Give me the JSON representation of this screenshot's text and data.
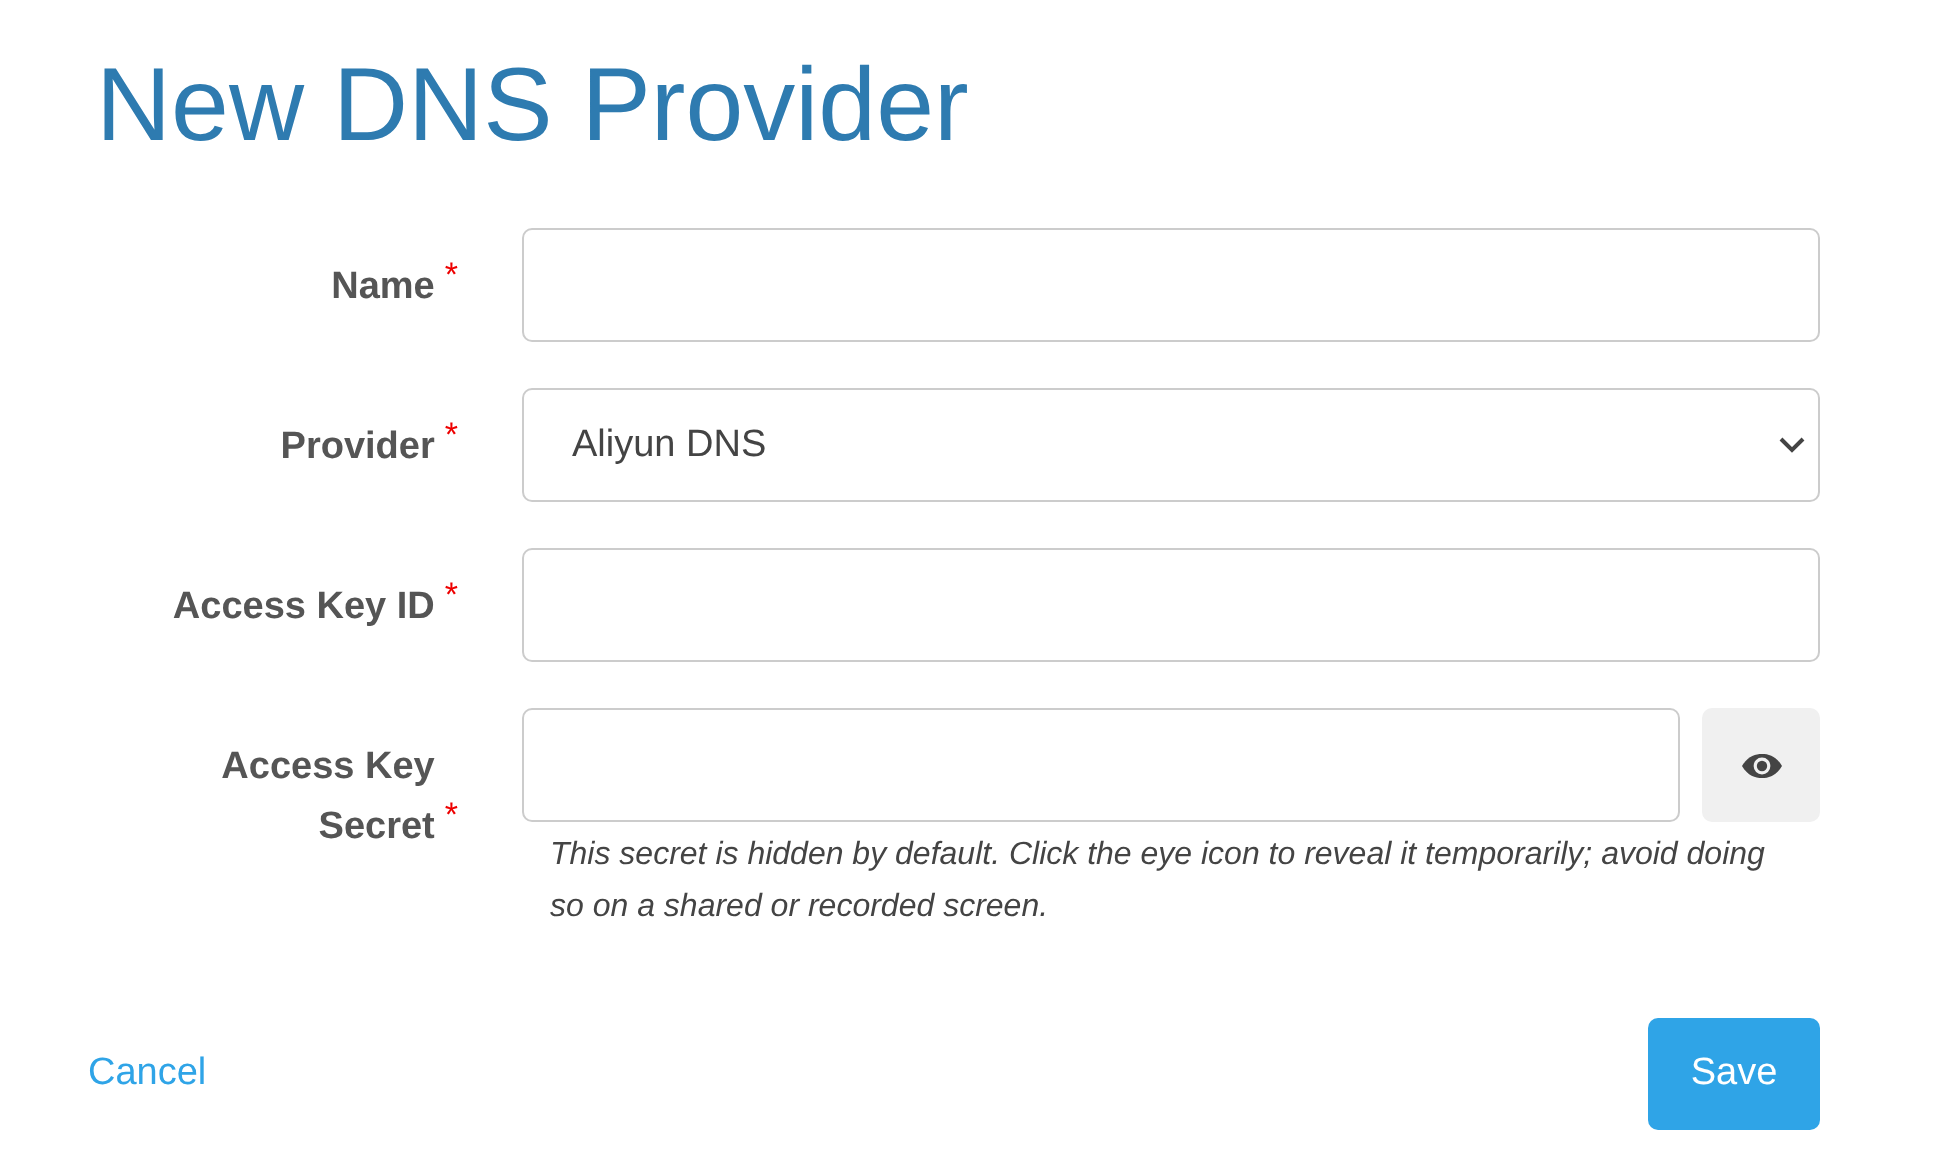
{
  "title": "New DNS Provider",
  "fields": [
    {
      "kind": "text",
      "label": "Name",
      "asterisk": "*"
    },
    {
      "kind": "select",
      "label": "Provider",
      "asterisk": "*",
      "value": "Aliyun DNS"
    },
    {
      "kind": "text",
      "label": "Access Key ID",
      "asterisk": "*"
    },
    {
      "kind": "secret",
      "label": "Access Key Secret",
      "asterisk": "*",
      "help": "This secret is hidden by default. Click the eye icon to reveal it temporarily; avoid doing so on a shared or recorded screen."
    }
  ],
  "cancel": "Cancel",
  "save": "Save"
}
